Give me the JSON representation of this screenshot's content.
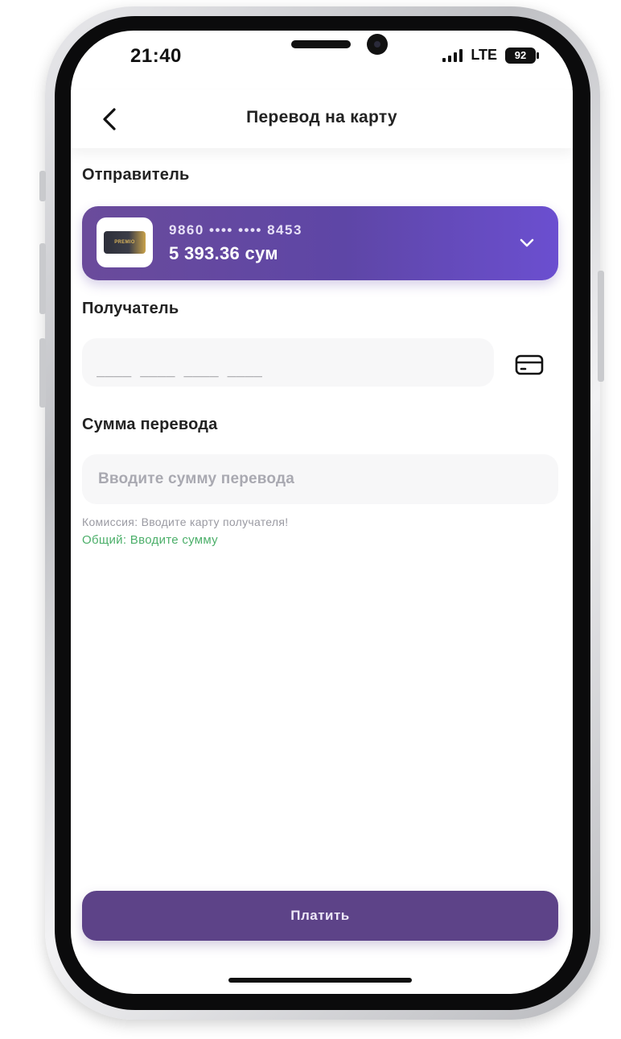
{
  "status_bar": {
    "time": "21:40",
    "network": "LTE",
    "battery": "92"
  },
  "header": {
    "title": "Перевод на карту",
    "back_icon": "chevron-left-icon"
  },
  "sender": {
    "label": "Отправитель",
    "card_number": "9860 •••• •••• 8453",
    "balance": "5 393.36 сум",
    "card_thumb_text": "PREMIO",
    "dropdown_icon": "chevron-down-icon"
  },
  "recipient": {
    "label": "Получатель",
    "input_mask": "____ ____ ____ ____",
    "scan_icon": "credit-card-icon"
  },
  "amount": {
    "label": "Сумма перевода",
    "placeholder": "Вводите сумму перевода"
  },
  "info": {
    "commission": "Комиссия: Вводите карту получателя!",
    "total": "Общий: Вводите сумму"
  },
  "actions": {
    "pay_label": "Платить"
  },
  "colors": {
    "accent": "#5E46A6",
    "button": "#5D4388",
    "success_text": "#4CAF6A"
  }
}
